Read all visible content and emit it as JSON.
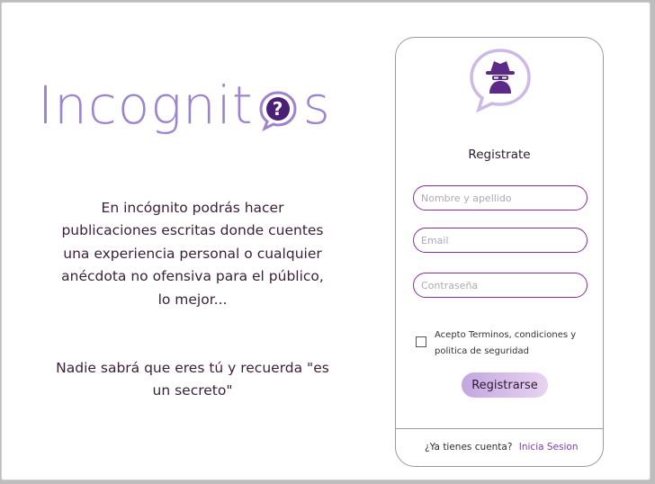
{
  "brand": {
    "name_part1": "Incognit",
    "name_part2": "s",
    "logo_color": "#9d84cf",
    "accent_dark": "#4a1f74",
    "field_border": "#8a2aa3"
  },
  "intro": {
    "paragraph1": "En incógnito podrás hacer publicaciones escritas donde cuentes una experiencia personal o cualquier anécdota no ofensiva para el público, lo mejor...",
    "paragraph2": "Nadie sabrá que eres tú y recuerda \"es un secreto\""
  },
  "register_card": {
    "title": "Registrate",
    "name_placeholder": "Nombre y apellido",
    "email_placeholder": "Email",
    "password_placeholder": "Contraseña",
    "terms_label": "Acepto Terminos, condiciones y politica de seguridad",
    "submit_label": "Registrarse",
    "have_account_text": "¿Ya tienes cuenta?",
    "login_link_label": "Inicia Sesion"
  },
  "icons": {
    "logo_badge": "question-bubble-icon",
    "card_badge": "spy-bubble-icon"
  }
}
